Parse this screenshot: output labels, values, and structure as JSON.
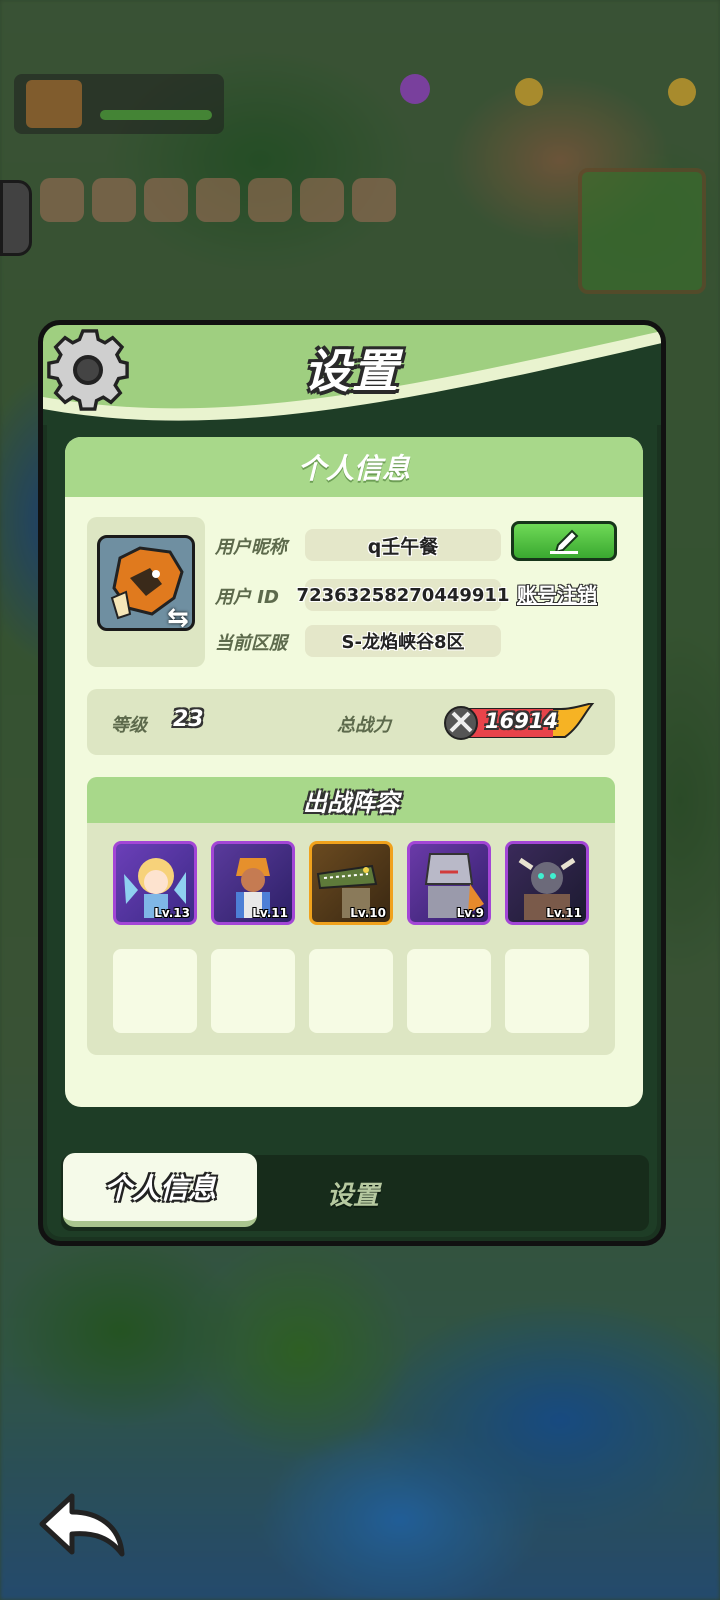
{
  "panel": {
    "title": "设置",
    "card_title": "个人信息"
  },
  "profile": {
    "nickname_label": "用户昵称",
    "nickname": "q壬午餐",
    "id_label": "用户  ID",
    "user_id": "72363258270449911",
    "server_label": "当前区服",
    "server": "S-龙焰峡谷8区",
    "deregister_label": "账号注销"
  },
  "stats": {
    "level_label": "等级",
    "level": "23",
    "power_label": "总战力",
    "power": "16914"
  },
  "lineup": {
    "title": "出战阵容",
    "heroes": [
      {
        "level": "Lv.13",
        "rarity": "purple"
      },
      {
        "level": "Lv.11",
        "rarity": "purple"
      },
      {
        "level": "Lv.10",
        "rarity": "orange"
      },
      {
        "level": "Lv.9",
        "rarity": "purple"
      },
      {
        "level": "Lv.11",
        "rarity": "purple"
      }
    ]
  },
  "tabs": {
    "active": "个人信息",
    "inactive": "设置"
  },
  "colors": {
    "header_green": "#9fcf80",
    "card_bg": "#f2fadd",
    "button_green": "#3aa930",
    "purple_frame": "#a346d6",
    "orange_frame": "#f0a21c"
  }
}
